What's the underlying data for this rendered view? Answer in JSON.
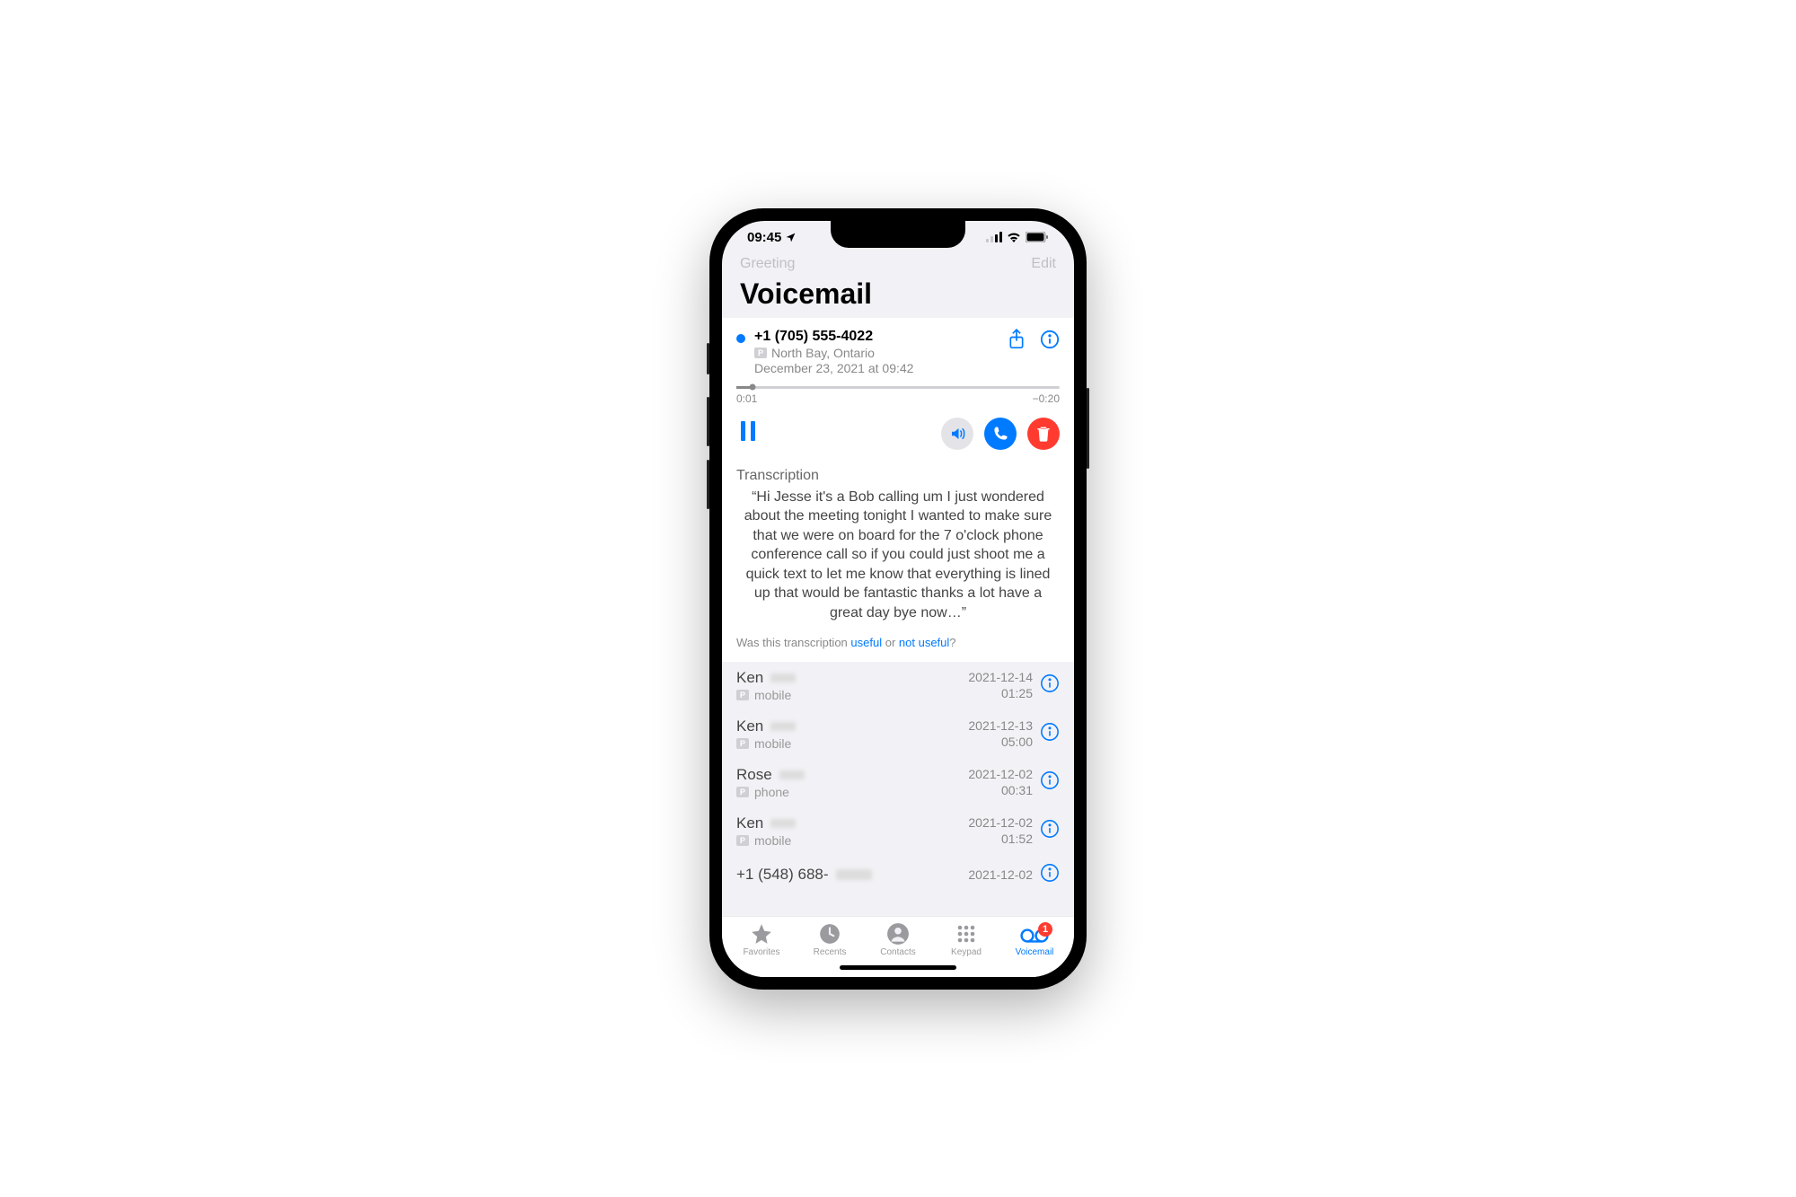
{
  "status": {
    "time": "09:45"
  },
  "nav": {
    "greeting": "Greeting",
    "edit": "Edit"
  },
  "title": "Voicemail",
  "detail": {
    "number": "+1 (705) 555-4022",
    "location": "North Bay, Ontario",
    "date": "December 23, 2021 at 09:42",
    "elapsed": "0:01",
    "remaining": "−0:20",
    "trans_label": "Transcription",
    "trans_body": "“Hi Jesse it's a Bob calling um I just wondered about the meeting tonight I wanted to make sure that we were on board for the 7 o'clock phone conference call so if you could just shoot me a quick text to let me know that everything is lined up that would be fantastic thanks a lot have a great day bye now…”",
    "feedback_prefix": "Was this transcription ",
    "feedback_useful": "useful",
    "feedback_or": " or ",
    "feedback_notuseful": "not useful",
    "feedback_q": "?"
  },
  "list": [
    {
      "name": "Ken",
      "sub": "mobile",
      "date": "2021-12-14",
      "duration": "01:25"
    },
    {
      "name": "Ken",
      "sub": "mobile",
      "date": "2021-12-13",
      "duration": "05:00"
    },
    {
      "name": "Rose",
      "sub": "phone",
      "date": "2021-12-02",
      "duration": "00:31"
    },
    {
      "name": "Ken",
      "sub": "mobile",
      "date": "2021-12-02",
      "duration": "01:52"
    },
    {
      "name": "+1 (548) 688-",
      "sub": "",
      "date": "2021-12-02",
      "duration": ""
    }
  ],
  "tabs": {
    "favorites": "Favorites",
    "recents": "Recents",
    "contacts": "Contacts",
    "keypad": "Keypad",
    "voicemail": "Voicemail",
    "badge": "1"
  }
}
